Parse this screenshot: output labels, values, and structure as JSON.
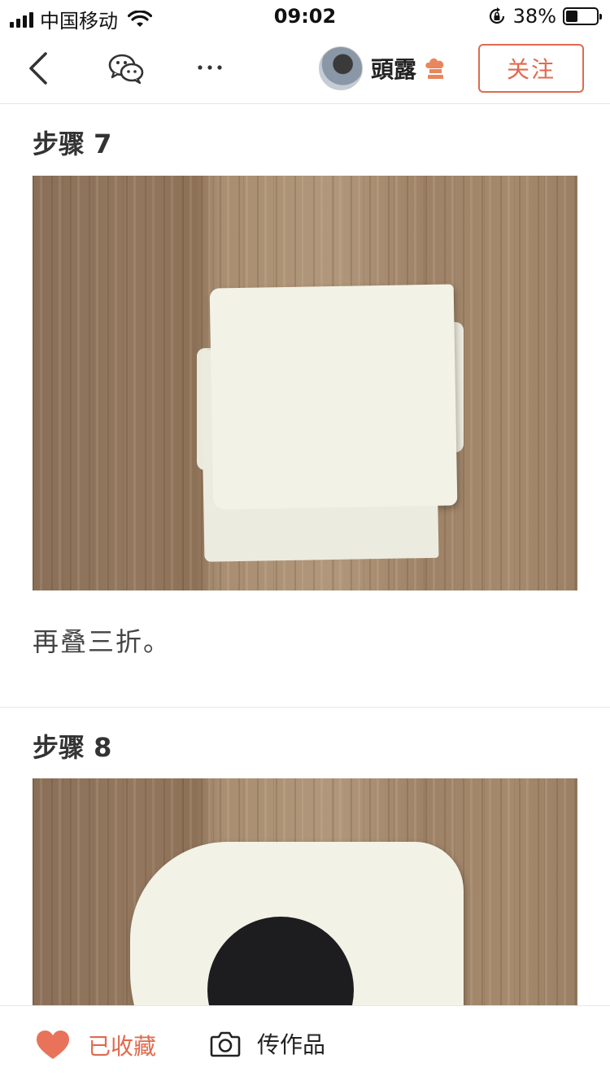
{
  "status_bar": {
    "carrier": "中国移动",
    "time": "09:02",
    "battery_pct": "38%",
    "battery_level": 0.38,
    "icons": [
      "signal-icon",
      "wifi-icon",
      "rotation-lock-icon",
      "battery-icon"
    ]
  },
  "nav": {
    "author_name": "頭露",
    "follow_label": "关注",
    "icons": [
      "back-icon",
      "wechat-icon",
      "more-icon",
      "chef-hat-icon"
    ],
    "accent_color": "#e06a4e"
  },
  "steps": [
    {
      "title": "步骤 7",
      "description": "再叠三折。"
    },
    {
      "title": "步骤 8",
      "description": ""
    }
  ],
  "bottom_bar": {
    "favorite_label": "已收藏",
    "upload_label": "传作品",
    "icons": [
      "heart-icon",
      "camera-icon"
    ]
  }
}
